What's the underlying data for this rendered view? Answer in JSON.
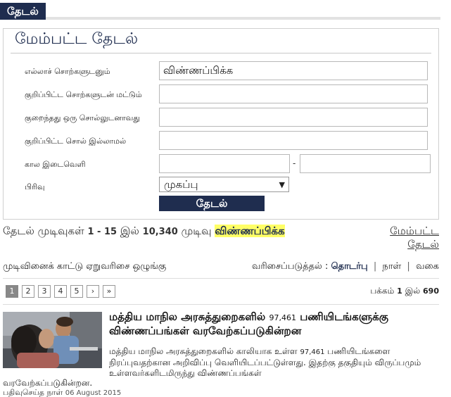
{
  "tab": {
    "label": "தேடல்"
  },
  "panel": {
    "title": "மேம்பட்ட தேடல்",
    "fields": [
      {
        "label": "எல்லாச் சொற்களுடனும்",
        "value": "விண்ணப்பிக்க"
      },
      {
        "label": "குறிப்பிட்ட சொற்களுடன் மட்டும்",
        "value": ""
      },
      {
        "label": "குறைந்தது ஒரு சொல்லுடனாவது",
        "value": ""
      },
      {
        "label": "குறிப்பிட்ட சொல் இல்லாமல்",
        "value": ""
      }
    ],
    "period": {
      "label": "கால இடைவெளி",
      "from": "",
      "to": "",
      "separator": "-"
    },
    "category": {
      "label": "பிரிவு",
      "selected": "முகப்பு"
    },
    "search_button": "தேடல்"
  },
  "summary": {
    "prefix": "தேடல் முடிவுகள்",
    "range": "1 - 15",
    "of": "இல்",
    "total": "10,340",
    "suffix": "முடிவு",
    "term": "விண்ணப்பிக்க"
  },
  "advanced_link": {
    "line1": "மேம்பட்ட",
    "line2": "தேடல்"
  },
  "options": {
    "label": "முடிவினைக் காட்டு ஏறுவரிசை ஒழுங்கு"
  },
  "sort": {
    "label": "வரிசைப்படுத்தல் :",
    "items": [
      "தொடர்பு",
      "நாள்",
      "வகை"
    ]
  },
  "pagination": {
    "pages": [
      "1",
      "2",
      "3",
      "4",
      "5"
    ],
    "next": "›",
    "last": "»",
    "info_label": "பக்கம்",
    "current": "1",
    "of": "இல்",
    "total": "690"
  },
  "result": {
    "title_a": "மத்திய மாநில அரசுத்துறைகளில்",
    "title_num": "97,461",
    "title_b": "பணியிடங்களுக்கு விண்ணப்பங்கள் வரவேற்கப்படுகின்றன",
    "desc_a": "மத்திய மாநில அரசுத்துறைகளில் காலியாக உள்ள",
    "desc_num": "97,461",
    "desc_b": "பணியிடங்களை நிரப்புவதற்கான அறிவிப்பு வெளியிடப்பட்டுள்ளது. இதற்கு தகுதியும் விருப்பமும் உள்ளவர்களிடமிருந்து விண்ணப்பங்கள்",
    "desc_c": "வரவேற்கப்படுகின்றன.",
    "date_label": "பதிவுசெய்த நாள்",
    "date": "06 August 2015"
  }
}
